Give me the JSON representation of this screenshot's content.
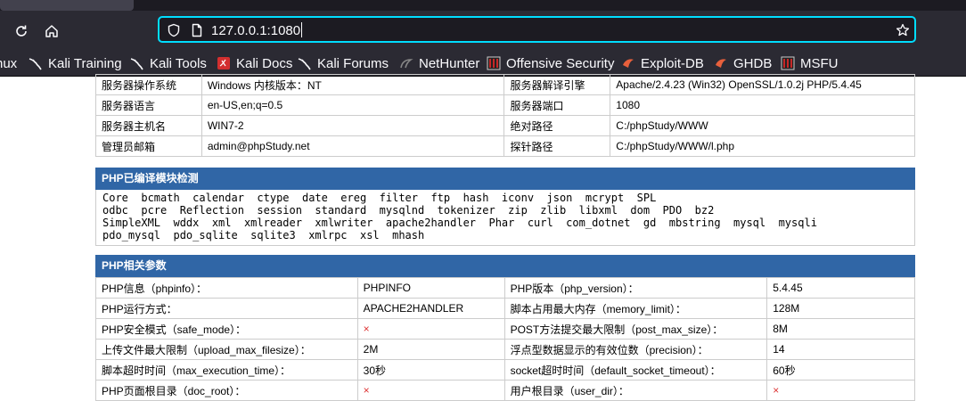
{
  "browser": {
    "url": "127.0.0.1:1080",
    "bookmarks": [
      {
        "label": "nux",
        "icon": "none"
      },
      {
        "label": "Kali Training",
        "icon": "kali-dragon-icon"
      },
      {
        "label": "Kali Tools",
        "icon": "kali-dragon-icon"
      },
      {
        "label": "Kali Docs",
        "icon": "kali-docs-icon"
      },
      {
        "label": "Kali Forums",
        "icon": "kali-dragon-icon"
      },
      {
        "label": "NetHunter",
        "icon": "nethunter-icon"
      },
      {
        "label": "Offensive Security",
        "icon": "offsec-icon"
      },
      {
        "label": "Exploit-DB",
        "icon": "exploitdb-icon"
      },
      {
        "label": "GHDB",
        "icon": "exploitdb-icon"
      },
      {
        "label": "MSFU",
        "icon": "offsec-icon"
      }
    ]
  },
  "server_info": {
    "rows": [
      [
        "服务器操作系统",
        "Windows  内核版本：NT",
        "服务器解译引擎",
        "Apache/2.4.23 (Win32) OpenSSL/1.0.2j PHP/5.4.45"
      ],
      [
        "服务器语言",
        "en-US,en;q=0.5",
        "服务器端口",
        "1080"
      ],
      [
        "服务器主机名",
        "WIN7-2",
        "绝对路径",
        "C:/phpStudy/WWW"
      ],
      [
        "管理员邮箱",
        "admin@phpStudy.net",
        "探针路径",
        "C:/phpStudy/WWW/l.php"
      ]
    ]
  },
  "modules_section": {
    "title": "PHP已编译模块检测",
    "lines": [
      "Core  bcmath  calendar  ctype  date  ereg  filter  ftp  hash  iconv  json  mcrypt  SPL",
      "odbc  pcre  Reflection  session  standard  mysqlnd  tokenizer  zip  zlib  libxml  dom  PDO  bz2",
      "SimpleXML  wddx  xml  xmlreader  xmlwriter  apache2handler  Phar  curl  com_dotnet  gd  mbstring  mysql  mysqli",
      "pdo_mysql  pdo_sqlite  sqlite3  xmlrpc  xsl  mhash"
    ]
  },
  "params_section": {
    "title": "PHP相关参数",
    "rows": [
      [
        "PHP信息（phpinfo）：",
        "PHPINFO",
        "PHP版本（php_version）：",
        "5.4.45"
      ],
      [
        "PHP运行方式：",
        "APACHE2HANDLER",
        "脚本占用最大内存（memory_limit）：",
        "128M"
      ],
      [
        "PHP安全模式（safe_mode）：",
        "×",
        "POST方法提交最大限制（post_max_size）：",
        "8M"
      ],
      [
        "上传文件最大限制（upload_max_filesize）：",
        "2M",
        "浮点型数据显示的有效位数（precision）：",
        "14"
      ],
      [
        "脚本超时时间（max_execution_time）：",
        "30秒",
        "socket超时时间（default_socket_timeout）：",
        "60秒"
      ],
      [
        "PHP页面根目录（doc_root）：",
        "×",
        "用户根目录（user_dir）：",
        "×"
      ]
    ]
  }
}
